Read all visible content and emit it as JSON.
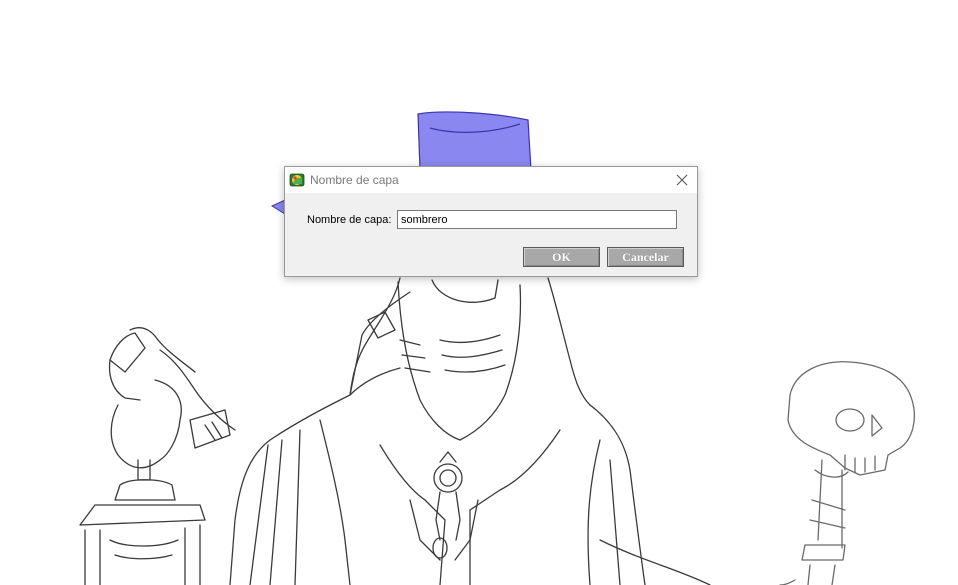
{
  "dialog": {
    "title": "Nombre de capa",
    "field_label": "Nombre de capa:",
    "field_value": "sombrero",
    "ok_label": "OK",
    "cancel_label": "Cancelar"
  },
  "colors": {
    "hat_fill": "#8a87f0",
    "hat_stroke": "#3a36a8",
    "canvas_background": "#ffffff",
    "dialog_background": "#f0f0f0",
    "button_background": "#a8a8a8"
  },
  "icons": {
    "app": "paint-app-icon",
    "close": "close-icon"
  }
}
